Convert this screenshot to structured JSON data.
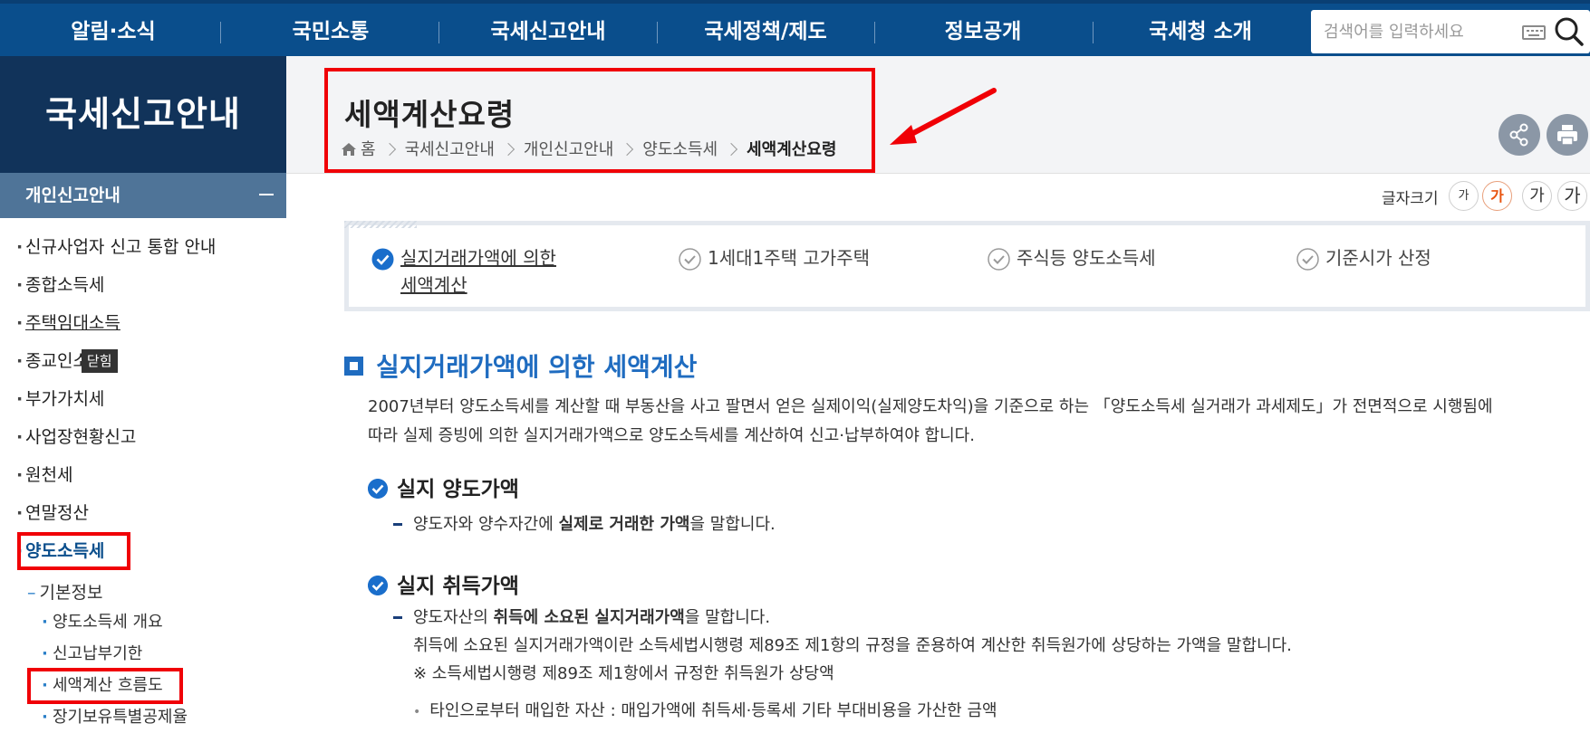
{
  "nav": {
    "items": [
      "알림·소식",
      "국민소통",
      "국세신고안내",
      "국세정책/제도",
      "정보공개",
      "국세청 소개"
    ],
    "search_placeholder": "검색어를 입력하세요"
  },
  "sidebar": {
    "title": "국세신고안내",
    "subtitle": "개인신고안내",
    "items": [
      "신규사업자 신고 통합 안내",
      "종합소득세",
      "주택임대소득",
      "종교인소",
      "부가가치세",
      "사업장현황신고",
      "원천세",
      "연말정산",
      "양도소득세"
    ],
    "tooltip": "닫힘",
    "sub_head": "기본정보",
    "sub_items": [
      "양도소득세 개요",
      "신고납부기한",
      "세액계산 흐름도",
      "장기보유특별공제율"
    ]
  },
  "page": {
    "title": "세액계산요령",
    "breadcrumb": [
      "홈",
      "국세신고안내",
      "개인신고안내",
      "양도소득세",
      "세액계산요령"
    ]
  },
  "font_size": {
    "label": "글자크기",
    "options": [
      "가",
      "가",
      "가",
      "가"
    ]
  },
  "tabs": [
    {
      "label_line1": "실지거래가액에 의한",
      "label_line2": "세액계산",
      "active": true
    },
    {
      "label_line1": "1세대1주택 고가주택",
      "active": false
    },
    {
      "label_line1": "주식등 양도소득세",
      "active": false
    },
    {
      "label_line1": "기준시가 산정",
      "active": false
    }
  ],
  "content": {
    "section_title": "실지거래가액에 의한 세액계산",
    "intro_line1": "2007년부터 양도소득세를 계산할 때 부동산을 사고 팔면서 얻은 실제이익(실제양도차익)을 기준으로 하는 「양도소득세 실거래가 과세제도」가 전면적으로 시행됨에",
    "intro_line2": "따라 실제 증빙에 의한 실지거래가액으로 양도소득세를 계산하여 신고·납부하여야 합니다.",
    "h_sale": "실지 양도가액",
    "sale_pre": "양도자와 양수자간에 ",
    "sale_bold": "실제로 거래한 가액",
    "sale_post": "을 말합니다.",
    "h_acq": "실지 취득가액",
    "acq_pre": "양도자산의 ",
    "acq_bold": "취득에 소요된 실지거래가액",
    "acq_post": "을 말합니다.",
    "acq_line2": "취득에 소요된 실지거래가액이란 소득세법시행령 제89조 제1항의 규정을 준용하여 계산한 취득원가에 상당하는 가액을 말합니다.",
    "acq_note": "※ 소득세법시행령 제89조 제1항에서 규정한 취득원가 상당액",
    "acq_item1": "타인으로부터 매입한 자산 : 매입가액에 취득세·등록세 기타 부대비용을 가산한 금액"
  },
  "colors": {
    "nav_bg": "#0a4e8c",
    "side_title_bg": "#11335a",
    "side_sub_bg": "#4f7498",
    "accent_blue": "#1f6cc0",
    "highlight_red": "#f00006",
    "font_active": "#e8530e"
  }
}
